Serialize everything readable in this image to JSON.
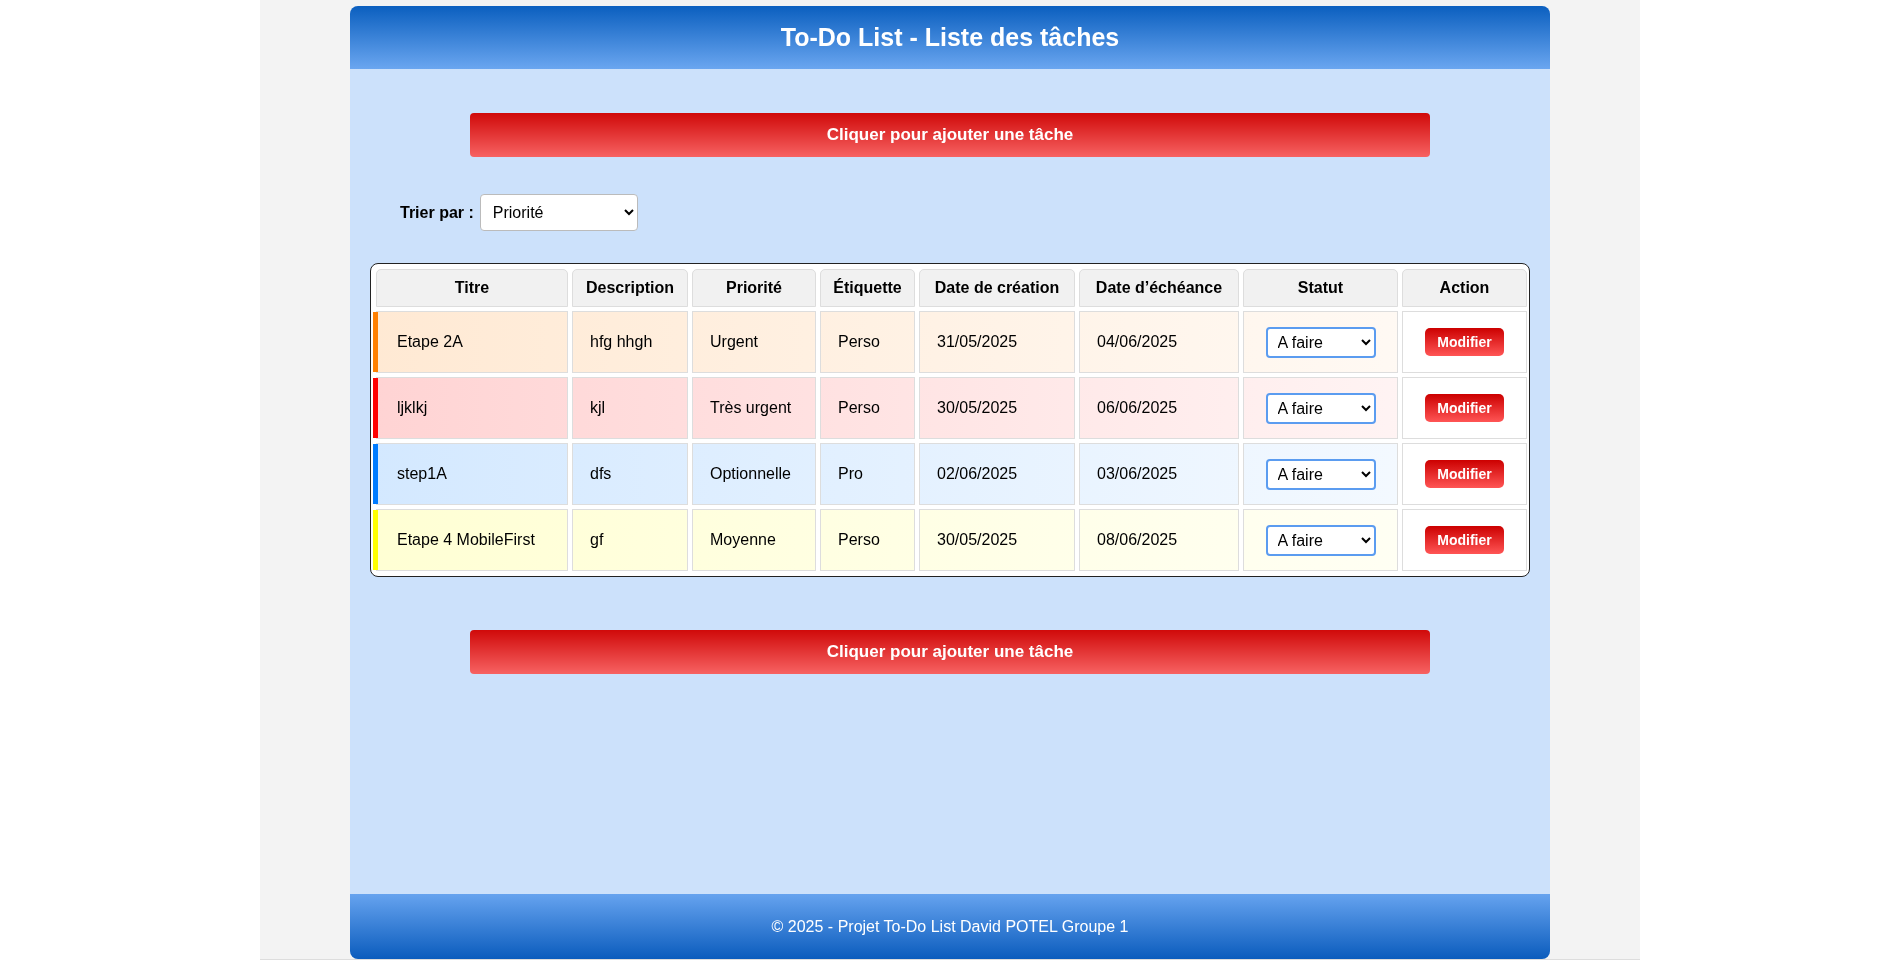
{
  "header": {
    "title": "To-Do List - Liste des tâches"
  },
  "add_button_top": "Cliquer pour ajouter une tâche",
  "sort": {
    "label": "Trier par :",
    "value": "Priorité"
  },
  "table": {
    "columns": [
      "Titre",
      "Description",
      "Priorité",
      "Étiquette",
      "Date de création",
      "Date d’échéance",
      "Statut",
      "Action"
    ],
    "rows": [
      {
        "color": "#ff7f00",
        "title": "Etape 2A",
        "description": "hfg hhgh",
        "priority": "Urgent",
        "tag": "Perso",
        "created": "31/05/2025",
        "due": "04/06/2025",
        "status": "A faire",
        "action": "Modifier"
      },
      {
        "color": "#ff0000",
        "title": "ljklkj",
        "description": "kjl",
        "priority": "Très urgent",
        "tag": "Perso",
        "created": "30/05/2025",
        "due": "06/06/2025",
        "status": "A faire",
        "action": "Modifier"
      },
      {
        "color": "#007bff",
        "title": "step1A",
        "description": "dfs",
        "priority": "Optionnelle",
        "tag": "Pro",
        "created": "02/06/2025",
        "due": "03/06/2025",
        "status": "A faire",
        "action": "Modifier"
      },
      {
        "color": "#ffff00",
        "title": "Etape 4 MobileFirst",
        "description": "gf",
        "priority": "Moyenne",
        "tag": "Perso",
        "created": "30/05/2025",
        "due": "08/06/2025",
        "status": "A faire",
        "action": "Modifier"
      }
    ]
  },
  "add_button_bottom": "Cliquer pour ajouter une tâche",
  "footer": "© 2025 - Projet To-Do List David POTEL Groupe 1"
}
